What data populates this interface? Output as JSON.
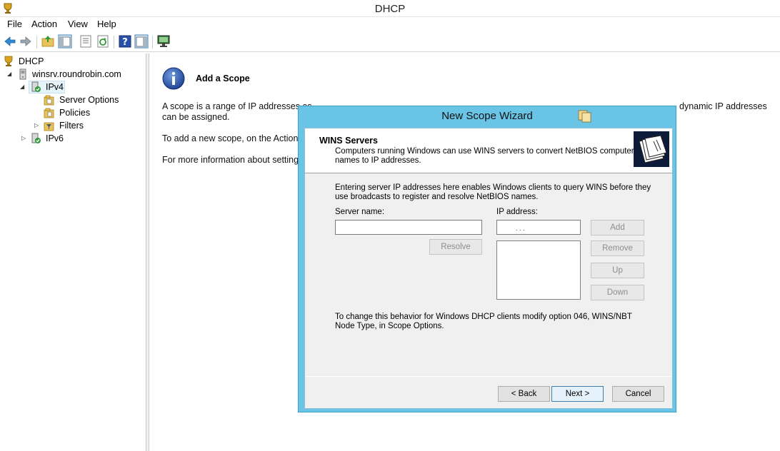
{
  "window": {
    "title": "DHCP"
  },
  "menu": [
    "File",
    "Action",
    "View",
    "Help"
  ],
  "toolbar": {
    "buttons": [
      "back-icon",
      "forward-icon",
      "up-folder-icon",
      "show-hide-console-tree-icon",
      "export-list-icon",
      "refresh-icon",
      "help-icon",
      "show-hide-action-pane-icon",
      "monitor-icon"
    ]
  },
  "tree": {
    "root": "DHCP",
    "server": "winsrv.roundrobin.com",
    "ipv4": "IPv4",
    "server_options": "Server Options",
    "policies": "Policies",
    "filters": "Filters",
    "ipv6": "IPv6"
  },
  "result": {
    "heading": "Add a Scope",
    "line1": "A scope is a range of IP addresses as",
    "line1_tail": "dynamic IP addresses",
    "line2": "can be assigned.",
    "line3": "To add a new scope, on the Action r",
    "line4": "For more information about setting"
  },
  "wizard": {
    "title": "New Scope Wizard",
    "header_title": "WINS Servers",
    "header_desc": "Computers running Windows can use WINS servers to convert NetBIOS computer names to IP addresses.",
    "intro": "Entering server IP addresses here enables Windows clients to query WINS before they use broadcasts to register and resolve NetBIOS names.",
    "server_name_label": "Server name:",
    "server_name_value": "",
    "ip_address_label": "IP address:",
    "ip_address_value": ".      .      .",
    "resolve": "Resolve",
    "add": "Add",
    "remove": "Remove",
    "up": "Up",
    "down": "Down",
    "footer_note": "To change this behavior for Windows DHCP clients modify option 046, WINS/NBT Node Type, in Scope Options.",
    "back": "< Back",
    "next": "Next >",
    "cancel": "Cancel"
  }
}
